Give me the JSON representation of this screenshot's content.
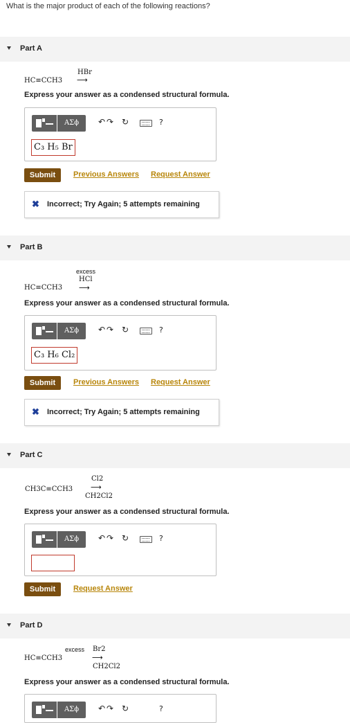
{
  "question": "What is the major product of each of the following reactions?",
  "parts": [
    {
      "title": "Part A",
      "reactant": "HC≡CCH3",
      "reagent_above": "HBr",
      "reagent_above_extra": "",
      "reagent_below": "",
      "arrow": "⟶",
      "prompt": "Express your answer as a condensed structural formula.",
      "answer": "C₃ H₅ Br",
      "submit": "Submit",
      "links": [
        "Previous Answers",
        "Request Answer"
      ],
      "feedback": "Incorrect; Try Again; 5 attempts remaining"
    },
    {
      "title": "Part B",
      "reactant": "HC≡CCH3",
      "reagent_above_extra": "excess",
      "reagent_above": "HCl",
      "reagent_below": "",
      "arrow": "⟶",
      "prompt": "Express your answer as a condensed structural formula.",
      "answer": "C₃ H₆ Cl₂",
      "submit": "Submit",
      "links": [
        "Previous Answers",
        "Request Answer"
      ],
      "feedback": "Incorrect; Try Again; 5 attempts remaining"
    },
    {
      "title": "Part C",
      "reactant": "CH3C≡CCH3",
      "reagent_above": "Cl2",
      "reagent_below": "CH2Cl2",
      "arrow": "⟶",
      "prompt": "Express your answer as a condensed structural formula.",
      "answer": "",
      "submit": "Submit",
      "links": [
        "Request Answer"
      ]
    },
    {
      "title": "Part D",
      "reactant": "HC≡CCH3",
      "reagent_above_extra": "excess",
      "reagent_above": "Br2",
      "reagent_below": "CH2Cl2",
      "arrow": "⟶",
      "prompt": "Express your answer as a condensed structural formula."
    }
  ],
  "toolbar": {
    "greek_label": "AΣϕ",
    "undo_icon": "↶",
    "redo_icon": "↷",
    "reset_icon": "↻",
    "help_label": "?",
    "x_icon": "✖"
  }
}
